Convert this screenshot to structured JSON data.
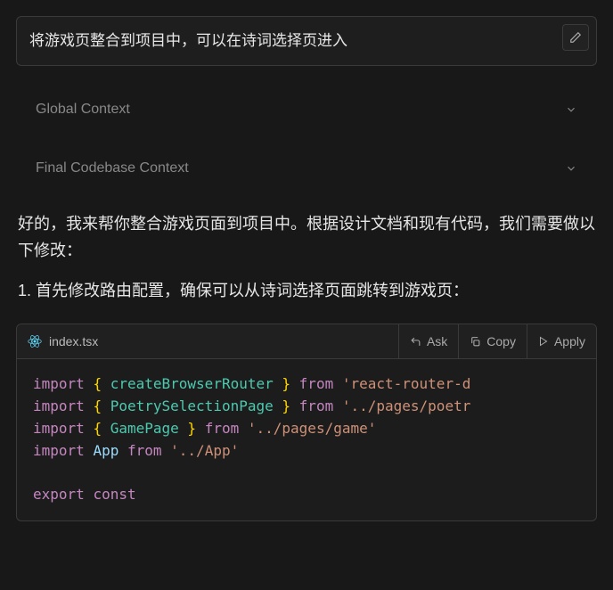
{
  "user_message": "将游戏页整合到项目中，可以在诗词选择页进入",
  "sections": {
    "global": "Global Context",
    "final": "Final Codebase Context"
  },
  "response": {
    "p1": "好的，我来帮你整合游戏页面到项目中。根据设计文档和现有代码，我们需要做以下修改：",
    "p2": "1. 首先修改路由配置，确保可以从诗词选择页面跳转到游戏页："
  },
  "code": {
    "filename": "index.tsx",
    "actions": {
      "ask": "Ask",
      "copy": "Copy",
      "apply": "Apply"
    },
    "lines": [
      [
        [
          "kw",
          "import"
        ],
        [
          "pl",
          " "
        ],
        [
          "br",
          "{"
        ],
        [
          "pl",
          " "
        ],
        [
          "fn",
          "createBrowserRouter"
        ],
        [
          "pl",
          " "
        ],
        [
          "br",
          "}"
        ],
        [
          "pl",
          " "
        ],
        [
          "kw",
          "from"
        ],
        [
          "pl",
          " "
        ],
        [
          "str",
          "'react-router-d"
        ]
      ],
      [
        [
          "kw",
          "import"
        ],
        [
          "pl",
          " "
        ],
        [
          "br",
          "{"
        ],
        [
          "pl",
          " "
        ],
        [
          "fn",
          "PoetrySelectionPage"
        ],
        [
          "pl",
          " "
        ],
        [
          "br",
          "}"
        ],
        [
          "pl",
          " "
        ],
        [
          "kw",
          "from"
        ],
        [
          "pl",
          " "
        ],
        [
          "str",
          "'../pages/poetr"
        ]
      ],
      [
        [
          "kw",
          "import"
        ],
        [
          "pl",
          " "
        ],
        [
          "br",
          "{"
        ],
        [
          "pl",
          " "
        ],
        [
          "fn",
          "GamePage"
        ],
        [
          "pl",
          " "
        ],
        [
          "br",
          "}"
        ],
        [
          "pl",
          " "
        ],
        [
          "kw",
          "from"
        ],
        [
          "pl",
          " "
        ],
        [
          "str",
          "'../pages/game'"
        ]
      ],
      [
        [
          "kw",
          "import"
        ],
        [
          "pl",
          " "
        ],
        [
          "id",
          "App"
        ],
        [
          "pl",
          " "
        ],
        [
          "kw",
          "from"
        ],
        [
          "pl",
          " "
        ],
        [
          "str",
          "'../App'"
        ]
      ],
      [],
      [
        [
          "kw",
          "export"
        ],
        [
          "pl",
          " "
        ],
        [
          "kw",
          "const"
        ],
        [
          "pl",
          " "
        ]
      ]
    ]
  }
}
